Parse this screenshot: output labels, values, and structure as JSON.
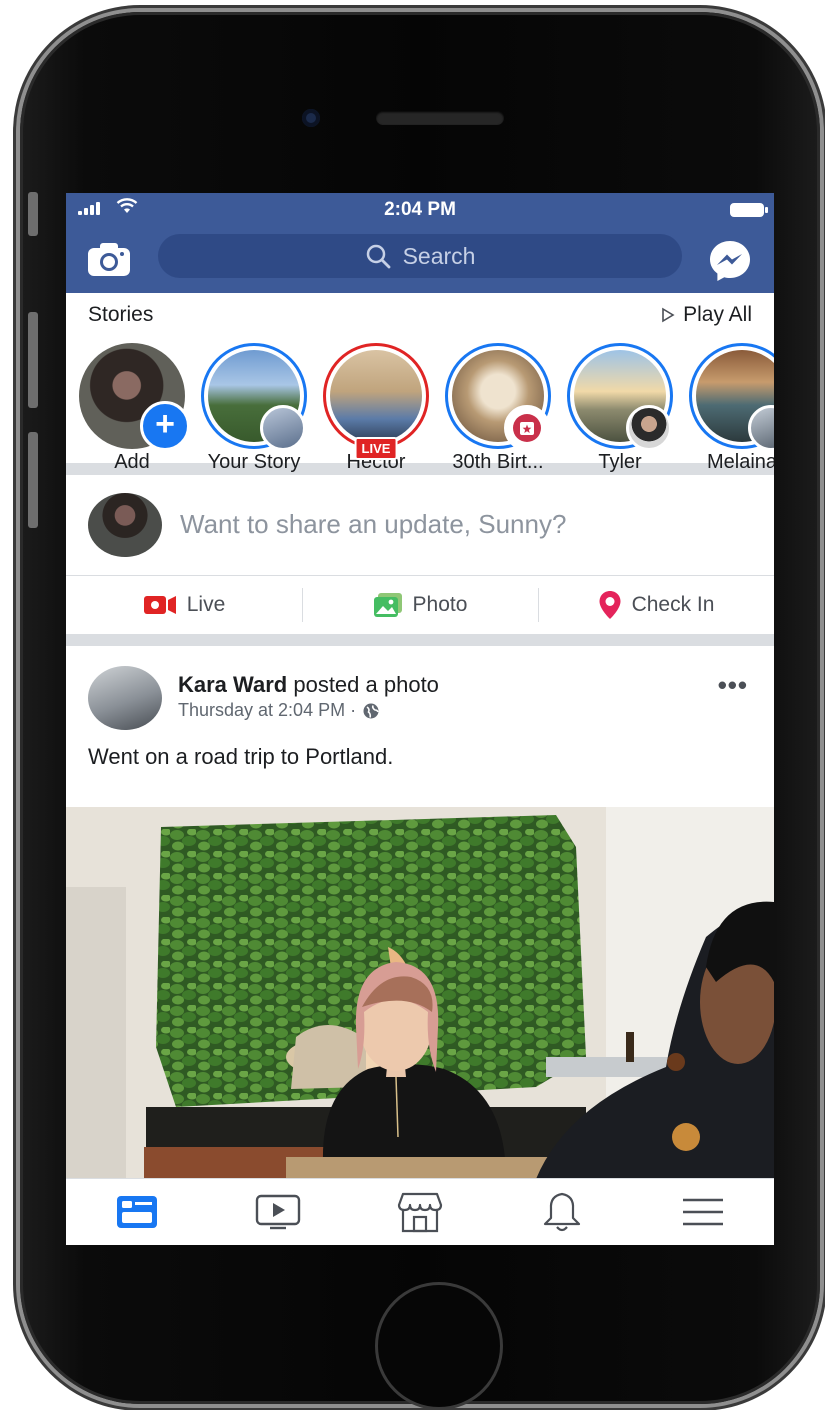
{
  "status_bar": {
    "time": "2:04 PM"
  },
  "search": {
    "placeholder": "Search"
  },
  "stories": {
    "title": "Stories",
    "play_all": "Play All",
    "items": [
      {
        "name": "Add"
      },
      {
        "name": "Your Story"
      },
      {
        "name": "Hector",
        "badge": "LIVE"
      },
      {
        "name": "30th Birt..."
      },
      {
        "name": "Tyler"
      },
      {
        "name": "Melaina"
      }
    ]
  },
  "composer": {
    "prompt": "Want to share an update, Sunny?"
  },
  "actions": {
    "live": "Live",
    "photo": "Photo",
    "check_in": "Check In"
  },
  "post": {
    "author": "Kara Ward",
    "verb": "posted a photo",
    "time": "Thursday at 2:04 PM ·",
    "text": "Went on a road trip to Portland.",
    "more": "•••"
  },
  "tabs": [
    "news-feed",
    "watch",
    "marketplace",
    "notifications",
    "menu"
  ],
  "colors": {
    "brand": "#3d5a98",
    "accent": "#1877f2",
    "live": "#e02424"
  }
}
